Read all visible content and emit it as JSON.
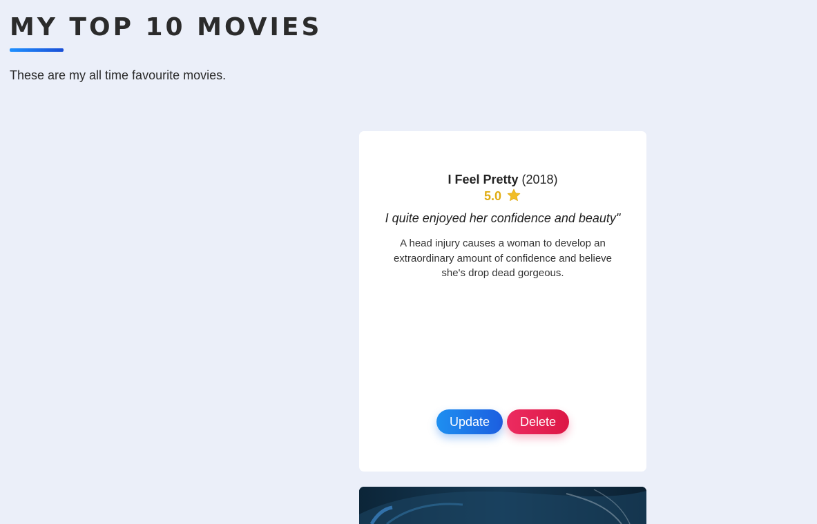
{
  "page": {
    "title": "MY TOP 10 MOVIES",
    "subtitle": "These are my all time favourite movies.",
    "accent_color": "#1e5ee0"
  },
  "movies": [
    {
      "title": "I Feel Pretty",
      "year": "(2018)",
      "rating": "5.0",
      "rating_icon": "star-icon",
      "review": "I quite enjoyed her confidence and beauty\"",
      "description": "A head injury causes a woman to develop an extraordinary amount of confidence and believe she's drop dead gorgeous.",
      "update_label": "Update",
      "delete_label": "Delete"
    }
  ],
  "colors": {
    "background": "#ebeff9",
    "card": "#ffffff",
    "rating": "#e0ac12",
    "update_button": "#1e8ff0",
    "delete_button": "#e3204f"
  }
}
